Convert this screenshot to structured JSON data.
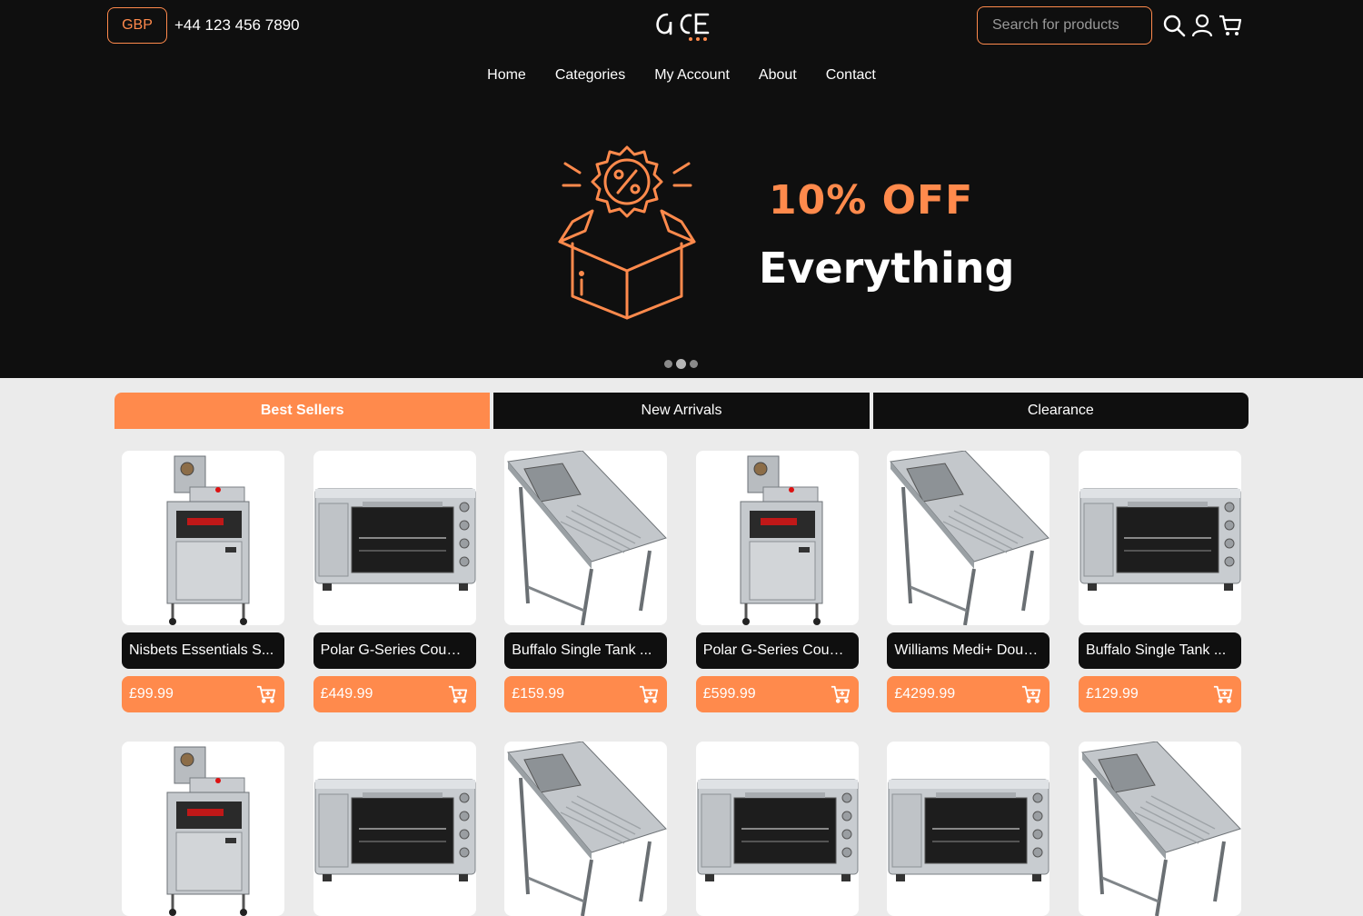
{
  "header": {
    "currency": "GBP",
    "phone": "+44 123 456 7890",
    "logo_text": "ace",
    "search_placeholder": "Search for products"
  },
  "nav": [
    "Home",
    "Categories",
    "My Account",
    "About",
    "Contact"
  ],
  "banner": {
    "line1": "10% OFF",
    "line2": "Everything",
    "slide_count": 3,
    "active_slide": 2
  },
  "tabs": [
    "Best Sellers",
    "New Arrivals",
    "Clearance"
  ],
  "colors": {
    "accent": "#ff8a4c",
    "dark": "#0f0f0f",
    "page_bg": "#ebebeb"
  },
  "products": [
    {
      "name": "Nisbets Essentials S...",
      "price": "£99.99",
      "image": "fryer"
    },
    {
      "name": "Polar G-Series Count...",
      "price": "£449.99",
      "image": "oven"
    },
    {
      "name": "Buffalo Single Tank ...",
      "price": "£159.99",
      "image": "sink"
    },
    {
      "name": "Polar G-Series Count...",
      "price": "£599.99",
      "image": "fryer"
    },
    {
      "name": "Williams Medi+ Doubl...",
      "price": "£4299.99",
      "image": "sink"
    },
    {
      "name": "Buffalo Single Tank ...",
      "price": "£129.99",
      "image": "oven"
    },
    {
      "name": "",
      "price": "",
      "image": "fryer"
    },
    {
      "name": "",
      "price": "",
      "image": "oven"
    },
    {
      "name": "",
      "price": "",
      "image": "sink"
    },
    {
      "name": "",
      "price": "",
      "image": "oven"
    },
    {
      "name": "",
      "price": "",
      "image": "oven"
    },
    {
      "name": "",
      "price": "",
      "image": "sink"
    }
  ]
}
